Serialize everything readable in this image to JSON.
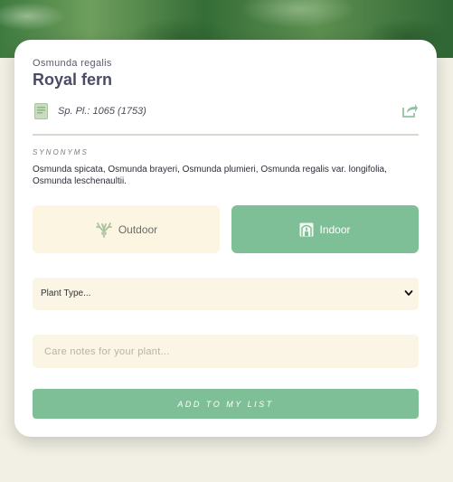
{
  "plant": {
    "scientific_name": "Osmunda regalis",
    "common_name": "Royal fern",
    "citation": "Sp. Pl.: 1065 (1753)"
  },
  "synonyms": {
    "heading": "SYNONYMS",
    "text": "Osmunda spicata, Osmunda brayeri, Osmunda plumieri, Osmunda regalis var. longifolia, Osmunda leschenaultii."
  },
  "location_toggle": {
    "outdoor_label": "Outdoor",
    "indoor_label": "Indoor",
    "selected": "Indoor"
  },
  "plant_type_select": {
    "selected_label": "Plant Type..."
  },
  "care_notes": {
    "placeholder": "Care notes for your plant...",
    "value": ""
  },
  "add_button": {
    "label": "ADD TO MY LIST"
  },
  "icons": {
    "citation": "book-icon",
    "share": "share-icon",
    "outdoor": "antler-tree-icon",
    "indoor": "house-plant-icon",
    "select": "chevron-down-icon"
  },
  "colors": {
    "accent_green": "#7fbf97",
    "cream": "#fbf5e2",
    "title": "#4b4b66"
  }
}
